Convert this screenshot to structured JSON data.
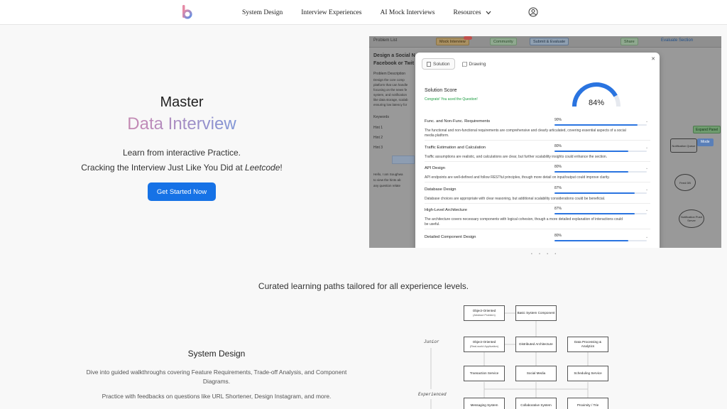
{
  "nav": {
    "links": [
      "System Design",
      "Interview Experiences",
      "AI Mock Interviews"
    ],
    "resources_label": "Resources"
  },
  "hero": {
    "line1": "Master",
    "title": "Data Interview",
    "sub1": "Learn from interactive Practice.",
    "sub2_prefix": "Cracking the Interview Just Like You Did at ",
    "sub2_em": "Leetcode",
    "sub2_suffix": "!",
    "cta": "Get Started Now"
  },
  "preview": {
    "topbar": {
      "problem_list": "Problem List",
      "badge": "Mock Interview",
      "community": "Community",
      "submit": "Submit & Evaluate",
      "share": "Share",
      "eval_section": "Evaluate Section"
    },
    "left": {
      "title_lines": [
        "Design a Social N",
        "Facebook or Twit"
      ],
      "desc_heading": "Problem Description",
      "desc_lines": [
        "Design the core comp",
        "platform that can handle",
        "focusing on the news fe",
        "system, and notification",
        "like data storage, scalab",
        "ensuring low latency for"
      ],
      "keywords": "Keywords",
      "hints": [
        "Hint 1",
        "Hint 2",
        "Hint 3"
      ],
      "chat_lines": [
        "Hello, I am Soughwa",
        "to view the hints ab",
        "any question relate"
      ]
    },
    "right": {
      "expand": "Expand Panel",
      "mode": "Mode",
      "nodes": [
        "Notification Queue",
        "Feed DB",
        "Notification Push Server"
      ]
    },
    "modal": {
      "tabs": [
        "Solution",
        "Drawing"
      ],
      "score_title": "Solution Score",
      "score_sub": "Congrats! You aced the Question!",
      "score_value": "84%",
      "score_fraction": 0.84,
      "rows": [
        {
          "name": "Func. and Non-Func. Requirements",
          "pct": "90%",
          "value": 0.9,
          "desc": [
            "The functional and non-functional requirements are comprehensive and clearly articulated, covering essential aspects of a social",
            "media platform."
          ]
        },
        {
          "name": "Traffic Estimation and Calculation",
          "pct": "80%",
          "value": 0.8,
          "desc": [
            "Traffic assumptions are realistic, and calculations are clear, but further scalability insights could enhance the section."
          ]
        },
        {
          "name": "API Design",
          "pct": "80%",
          "value": 0.8,
          "desc": [
            "API endpoints are well-defined and follow RESTful principles, though more detail on input/output could improve clarity."
          ]
        },
        {
          "name": "Database Design",
          "pct": "87%",
          "value": 0.87,
          "desc": [
            "Database choices are appropriate with clear reasoning, but additional scalability considerations could be beneficial."
          ]
        },
        {
          "name": "High-Level Architecture",
          "pct": "87%",
          "value": 0.87,
          "desc": [
            "The architecture covers necessary components with logical cohesion, though a more detailed explanation of interactions could",
            "be useful."
          ]
        },
        {
          "name": "Detailed Component Design",
          "pct": "80%",
          "value": 0.8,
          "desc": []
        }
      ]
    }
  },
  "section": {
    "curated": "Curated learning paths tailored for all experience levels.",
    "title": "System Design",
    "desc1": "Dive into guided walkthroughs covering Feature Requirements, Trade-off Analysis, and Component Diagrams.",
    "desc2": "Practice with feedbacks on questions like URL Shortener, Design Instagram, and more."
  },
  "diagram": {
    "levels": [
      "Junior",
      "Experienced"
    ],
    "boxes": [
      {
        "title": "Object-Oriented",
        "sub": "(Abstract Problem)"
      },
      {
        "title": "Basic System Component",
        "sub": ""
      },
      {
        "title": "Object-Oriented",
        "sub": "(Real-world Application)"
      },
      {
        "title": "Distributed Architecture",
        "sub": ""
      },
      {
        "title": "Data Processing & Analytics",
        "sub": ""
      },
      {
        "title": "Transaction Service",
        "sub": ""
      },
      {
        "title": "Social Media",
        "sub": ""
      },
      {
        "title": "Scheduling Service",
        "sub": ""
      },
      {
        "title": "Messaging System",
        "sub": ""
      },
      {
        "title": "Collaborative System",
        "sub": ""
      },
      {
        "title": "Proximity / Trie",
        "sub": ""
      }
    ]
  }
}
